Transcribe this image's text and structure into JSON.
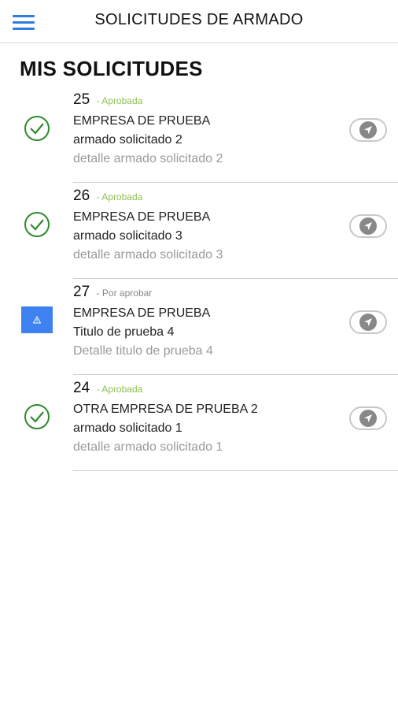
{
  "header": {
    "title": "SOLICITUDES DE ARMADO",
    "menu_icon": "hamburger-menu-icon",
    "accent_color": "#2f7de1"
  },
  "page": {
    "title": "MIS SOLICITUDES"
  },
  "requests": [
    {
      "number": "25",
      "status": "- Aprobada",
      "status_type": "approved",
      "status_icon": "check-circle-icon",
      "company": "EMPRESA DE PRUEBA",
      "title": "armado solicitado 2",
      "detail": "detalle armado solicitado 2",
      "action_icon": "navigation-arrow-icon"
    },
    {
      "number": "26",
      "status": "- Aprobada",
      "status_type": "approved",
      "status_icon": "check-circle-icon",
      "company": "EMPRESA DE PRUEBA",
      "title": "armado solicitado 3",
      "detail": "detalle armado solicitado 3",
      "action_icon": "navigation-arrow-icon"
    },
    {
      "number": "27",
      "status": "- Por aprobar",
      "status_type": "pending",
      "status_icon": "warning-icon",
      "company": "EMPRESA DE PRUEBA",
      "title": "Titulo de prueba 4",
      "detail": "Detalle titulo de prueba 4",
      "action_icon": "navigation-arrow-icon"
    },
    {
      "number": "24",
      "status": "- Aprobada",
      "status_type": "approved",
      "status_icon": "check-circle-icon",
      "company": "OTRA EMPRESA DE PRUEBA 2",
      "title": "armado solicitado 1",
      "detail": "detalle armado solicitado 1",
      "action_icon": "navigation-arrow-icon"
    }
  ],
  "colors": {
    "approved": "#8cc152",
    "check": "#2e8b2e",
    "pending_box": "#3d82f0",
    "detail_text": "#9a9a9a"
  }
}
